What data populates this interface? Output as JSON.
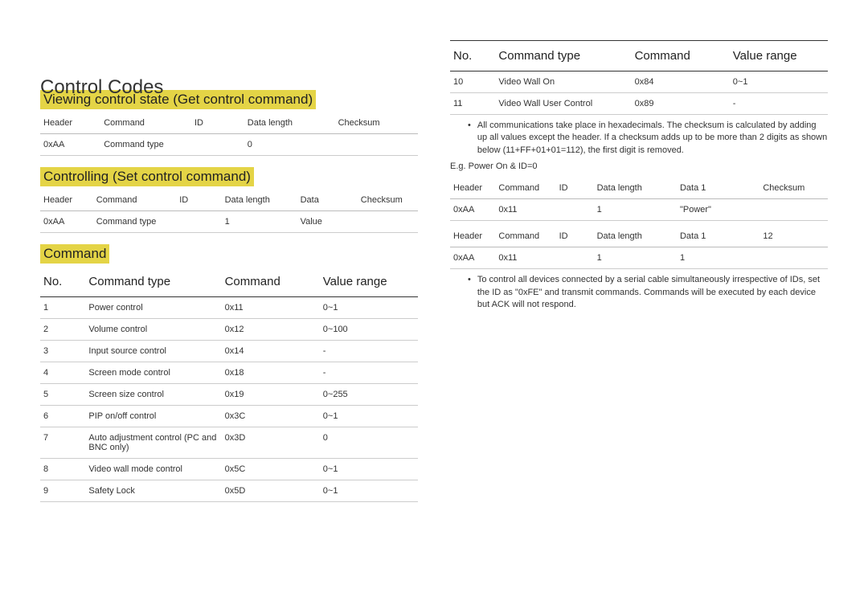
{
  "title": "Control Codes",
  "sections": {
    "view_state": "Viewing control state (Get control command)",
    "controlling": "Controlling (Set control command)",
    "command": "Command"
  },
  "get_table": {
    "headers": [
      "Header",
      "Command",
      "ID",
      "Data length",
      "Checksum"
    ],
    "row": [
      "0xAA",
      "Command type",
      "",
      "0",
      ""
    ]
  },
  "set_table": {
    "headers": [
      "Header",
      "Command",
      "ID",
      "Data length",
      "Data",
      "Checksum"
    ],
    "row": [
      "0xAA",
      "Command type",
      "",
      "1",
      "Value",
      ""
    ]
  },
  "cmd_headers": [
    "No.",
    "Command type",
    "Command",
    "Value range"
  ],
  "cmd_rows_left": [
    {
      "no": "1",
      "type": "Power control",
      "cmd": "0x11",
      "range": "0~1"
    },
    {
      "no": "2",
      "type": "Volume control",
      "cmd": "0x12",
      "range": "0~100"
    },
    {
      "no": "3",
      "type": "Input source control",
      "cmd": "0x14",
      "range": "-"
    },
    {
      "no": "4",
      "type": "Screen mode control",
      "cmd": "0x18",
      "range": "-"
    },
    {
      "no": "5",
      "type": "Screen size control",
      "cmd": "0x19",
      "range": "0~255"
    },
    {
      "no": "6",
      "type": "PIP on/off control",
      "cmd": "0x3C",
      "range": "0~1"
    },
    {
      "no": "7",
      "type": "Auto adjustment control (PC and BNC only)",
      "cmd": "0x3D",
      "range": "0"
    },
    {
      "no": "8",
      "type": "Video wall mode control",
      "cmd": "0x5C",
      "range": "0~1"
    },
    {
      "no": "9",
      "type": "Safety Lock",
      "cmd": "0x5D",
      "range": "0~1"
    }
  ],
  "cmd_rows_right": [
    {
      "no": "10",
      "type": "Video Wall On",
      "cmd": "0x84",
      "range": "0~1"
    },
    {
      "no": "11",
      "type": "Video Wall User Control",
      "cmd": "0x89",
      "range": "-"
    }
  ],
  "note1": "All communications take place in hexadecimals. The checksum is calculated by adding up all values except the header. If a checksum adds up to be more than 2 digits as shown below (11+FF+01+01=112), the first digit is removed.",
  "example_label": "E.g. Power On & ID=0",
  "ex1": {
    "headers": [
      "Header",
      "Command",
      "ID",
      "Data length",
      "Data 1",
      "Checksum"
    ],
    "row": [
      "0xAA",
      "0x11",
      "",
      "1",
      "\"Power\"",
      ""
    ]
  },
  "ex2": {
    "headers": [
      "Header",
      "Command",
      "ID",
      "Data length",
      "Data 1",
      "12"
    ],
    "row": [
      "0xAA",
      "0x11",
      "",
      "1",
      "1",
      ""
    ]
  },
  "note2": "To control all devices connected by a serial cable simultaneously irrespective of IDs, set the ID as \"0xFE\" and transmit commands. Commands will be executed by each device but ACK will not respond."
}
